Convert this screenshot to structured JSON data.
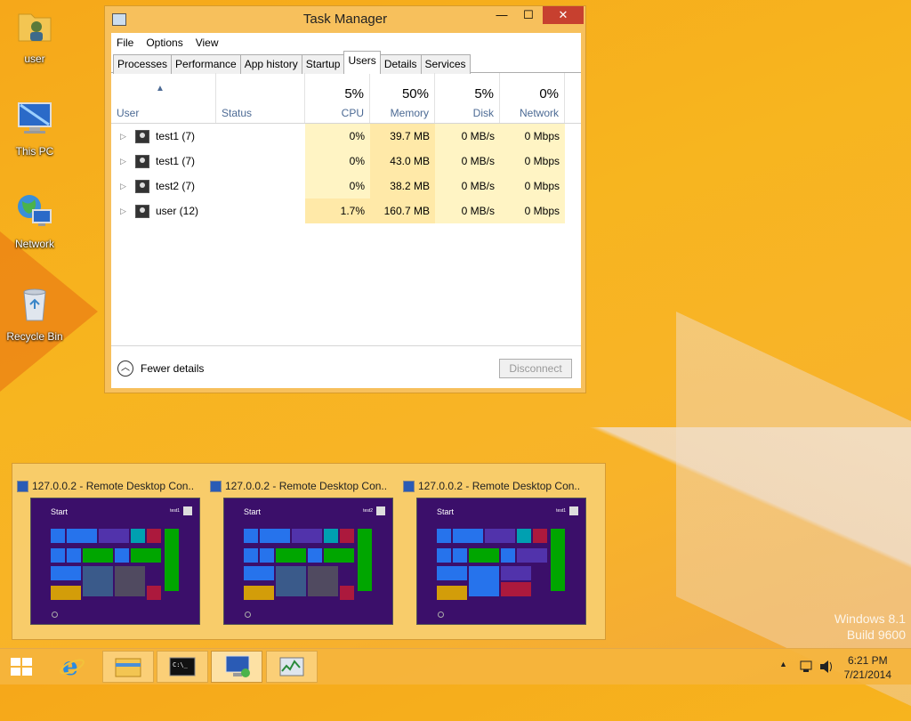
{
  "desktop": {
    "icons": [
      {
        "label": "user"
      },
      {
        "label": "This PC"
      },
      {
        "label": "Network"
      },
      {
        "label": "Recycle Bin"
      }
    ],
    "watermark": {
      "line1": "Windows 8.1",
      "line2": "Build 9600"
    }
  },
  "task_manager": {
    "title": "Task Manager",
    "window_controls": {
      "minimize": "—",
      "maximize": "☐",
      "close": "✕"
    },
    "menu": [
      "File",
      "Options",
      "View"
    ],
    "tabs": [
      "Processes",
      "Performance",
      "App history",
      "Startup",
      "Users",
      "Details",
      "Services"
    ],
    "active_tab": "Users",
    "columns": {
      "user": {
        "label": "User"
      },
      "status": {
        "label": "Status"
      },
      "cpu": {
        "label": "CPU",
        "percent": "5%"
      },
      "memory": {
        "label": "Memory",
        "percent": "50%"
      },
      "disk": {
        "label": "Disk",
        "percent": "5%"
      },
      "network": {
        "label": "Network",
        "percent": "0%"
      }
    },
    "rows": [
      {
        "user": "test1 (7)",
        "status": "",
        "cpu": "0%",
        "memory": "39.7 MB",
        "disk": "0 MB/s",
        "network": "0 Mbps"
      },
      {
        "user": "test1 (7)",
        "status": "",
        "cpu": "0%",
        "memory": "43.0 MB",
        "disk": "0 MB/s",
        "network": "0 Mbps"
      },
      {
        "user": "test2 (7)",
        "status": "",
        "cpu": "0%",
        "memory": "38.2 MB",
        "disk": "0 MB/s",
        "network": "0 Mbps"
      },
      {
        "user": "user (12)",
        "status": "",
        "cpu": "1.7%",
        "memory": "160.7 MB",
        "disk": "0 MB/s",
        "network": "0 Mbps"
      }
    ],
    "fewer_details": "Fewer details",
    "disconnect": "Disconnect"
  },
  "thumbnails": [
    {
      "title": "127.0.0.2 - Remote Desktop Con...",
      "start": "Start",
      "user": "test1"
    },
    {
      "title": "127.0.0.2 - Remote Desktop Con...",
      "start": "Start",
      "user": "test2"
    },
    {
      "title": "127.0.0.2 - Remote Desktop Con...",
      "start": "Start",
      "user": "test1"
    }
  ],
  "taskbar": {
    "items": [
      "start-icon",
      "internet-explorer-icon",
      "file-explorer-icon",
      "command-prompt-icon",
      "remote-desktop-icon",
      "task-manager-icon"
    ],
    "clock": {
      "time": "6:21 PM",
      "date": "7/21/2014"
    }
  },
  "colors": {
    "desktop_bg": "#f6a81a",
    "window_frame": "#f7c05c",
    "close_button": "#c7402f",
    "heat_light": "#fff4c4",
    "heat_medium": "#ffe9a8",
    "header_label": "#4c6a94",
    "start_screen_bg": "#3b0f6a"
  }
}
